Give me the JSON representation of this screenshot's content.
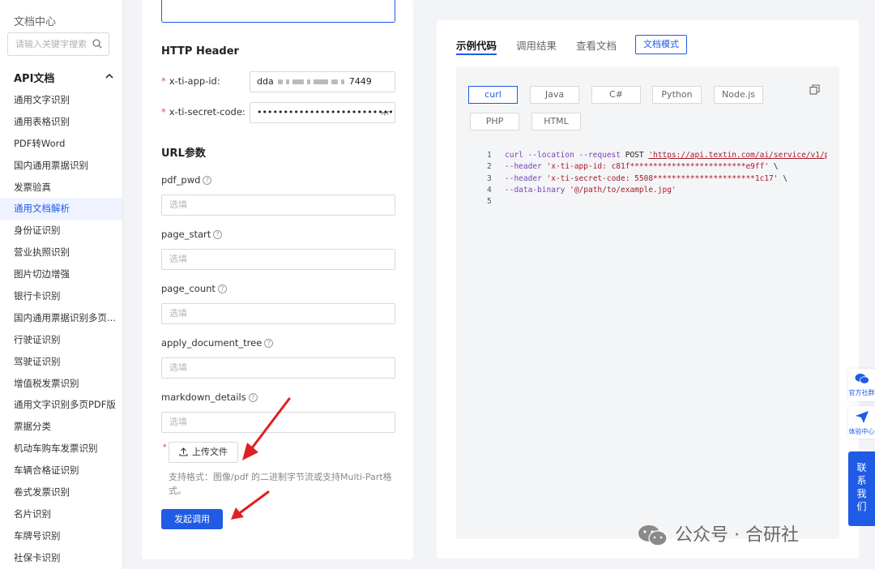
{
  "sidebar": {
    "title": "文档中心",
    "search_placeholder": "请输入关键字搜索",
    "section": "API文档",
    "items": [
      "通用文字识别",
      "通用表格识别",
      "PDF转Word",
      "国内通用票据识别",
      "发票验真",
      "通用文档解析",
      "身份证识别",
      "营业执照识别",
      "图片切边增强",
      "银行卡识别",
      "国内通用票据识别多页...",
      "行驶证识别",
      "驾驶证识别",
      "增值税发票识别",
      "通用文字识别多页PDF版",
      "票据分类",
      "机动车购车发票识别",
      "车辆合格证识别",
      "卷式发票识别",
      "名片识别",
      "车牌号识别",
      "社保卡识别"
    ],
    "active_index": 5
  },
  "form": {
    "http_header_title": "HTTP Header",
    "app_id_label": "x-ti-app-id:",
    "app_id_value_prefix": "dda",
    "app_id_value_suffix": "7449",
    "secret_label": "x-ti-secret-code:",
    "secret_value": "•••••••••••••••••••••••••••••",
    "url_params_title": "URL参数",
    "fields": [
      {
        "name": "pdf_pwd",
        "placeholder": "选填"
      },
      {
        "name": "page_start",
        "placeholder": "选填"
      },
      {
        "name": "page_count",
        "placeholder": "选填"
      },
      {
        "name": "apply_document_tree",
        "placeholder": "选填"
      },
      {
        "name": "markdown_details",
        "placeholder": "选填"
      }
    ],
    "help_glyph": "?",
    "required_mark": "*",
    "upload_label": "上传文件",
    "upload_hint": "支持格式：图像/pdf 的二进制字节流或支持Multi-Part格式。",
    "submit_label": "发起调用"
  },
  "code_panel": {
    "tabs": [
      "示例代码",
      "调用结果",
      "查看文档"
    ],
    "active_tab": 0,
    "doc_mode_label": "文档模式",
    "languages": [
      "curl",
      "Java",
      "C#",
      "Python",
      "Node.js",
      "PHP",
      "HTML"
    ],
    "active_language": 0,
    "code_lines": [
      {
        "n": "1",
        "kw": "curl --location --request",
        "plain": " POST ",
        "str": "'https://api.textin.com/ai/service/v1/p"
      },
      {
        "n": "2",
        "kw": "--header",
        "plain": " ",
        "str": "'x-ti-app-id: c81f*************************e9ff'",
        "tail": " \\"
      },
      {
        "n": "3",
        "kw": "--header",
        "plain": " ",
        "str": "'x-ti-secret-code: 5508**********************1c17'",
        "tail": " \\"
      },
      {
        "n": "4",
        "kw": "--data-binary",
        "plain": " ",
        "str": "'@/path/to/example.jpg'"
      },
      {
        "n": "5"
      }
    ]
  },
  "floating": {
    "community_label": "官方社群",
    "experience_label": "体验中心",
    "contact_label": "联系我们"
  },
  "watermark": "公众号 · 合研社",
  "colors": {
    "accent": "#1f5be5",
    "required": "#e34d4d",
    "annotation_arrow": "#e02020"
  }
}
